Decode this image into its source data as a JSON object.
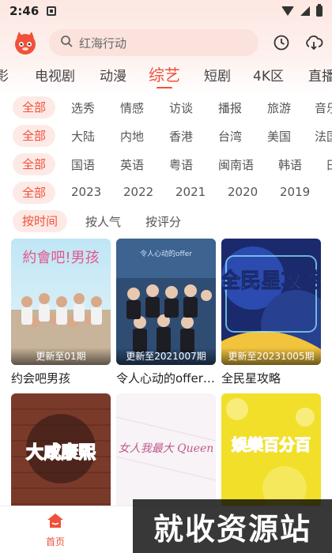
{
  "status_bar": {
    "time": "2:46"
  },
  "search": {
    "placeholder": "红海行动"
  },
  "channels": [
    "影",
    "电视剧",
    "动漫",
    "综艺",
    "短剧",
    "4K区",
    "直播"
  ],
  "active_channel": "综艺",
  "filters": {
    "type": {
      "all": "全部",
      "options": [
        "选秀",
        "情感",
        "访谈",
        "播报",
        "旅游",
        "音乐"
      ]
    },
    "region": {
      "all": "全部",
      "options": [
        "大陆",
        "内地",
        "香港",
        "台湾",
        "美国",
        "法国"
      ]
    },
    "language": {
      "all": "全部",
      "options": [
        "国语",
        "英语",
        "粤语",
        "闽南语",
        "韩语",
        "日"
      ]
    },
    "year": {
      "all": "全部",
      "options": [
        "2023",
        "2022",
        "2021",
        "2020",
        "2019"
      ]
    },
    "sort": {
      "selected": "按时间",
      "options": [
        "按人气",
        "按评分"
      ]
    }
  },
  "shows": [
    {
      "title": "约会吧男孩",
      "update": "更新至01期",
      "poster_text": "約會吧!男孩"
    },
    {
      "title": "令人心动的offer第三季",
      "update": "更新至2021007期",
      "poster_text": "令人心动的offer"
    },
    {
      "title": "全民星攻略",
      "update": "更新至20231005期",
      "poster_text": "全民星攻略"
    },
    {
      "title": "",
      "update": "",
      "poster_text": "大咸康熙"
    },
    {
      "title": "",
      "update": "",
      "poster_text": "女人我最大 Queen"
    },
    {
      "title": "",
      "update": "",
      "poster_text": "娛樂百分百"
    }
  ],
  "bottom_nav": {
    "home": "首页"
  },
  "watermark": "就收资源站",
  "colors": {
    "accent": "#f0513a",
    "chip_bg": "#fdeae6",
    "search_bg": "#fbe2dc"
  }
}
